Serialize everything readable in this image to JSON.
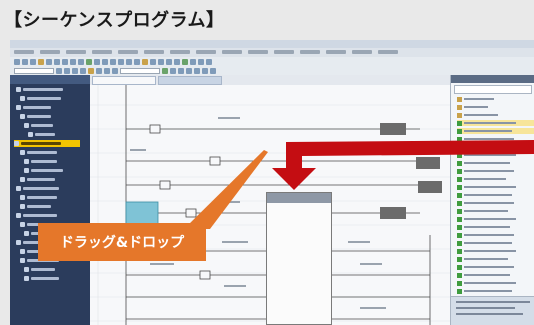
{
  "page": {
    "title": "【シーケンスプログラム】"
  },
  "callout": {
    "label": "ドラッグ&ドロップ"
  },
  "colors": {
    "accent_orange": "#e5772a",
    "drag_arrow": "#c40d12",
    "nav_bg": "#2b3c5c",
    "nav_selected": "#f2c400",
    "library_item_icon": "#3f9c3f"
  },
  "icons": {
    "drag_arrow": "drag-drop-arrow-icon",
    "library_item": "function-block-icon",
    "project_item": "folder-icon"
  }
}
